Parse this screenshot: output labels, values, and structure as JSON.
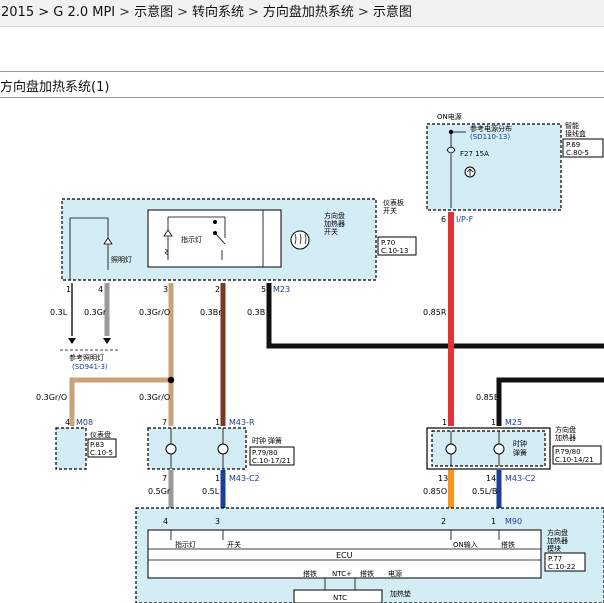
{
  "breadcrumb": {
    "items": [
      "2015 > G 2.0 MPI",
      "示意图",
      "转向系统",
      "方向盘加热系统",
      "示意图"
    ],
    "separator": ">"
  },
  "page_title": "方向盘加热系统(1)",
  "diagram": {
    "top_right_box": {
      "label": "ON电源",
      "ref_label": "参考电源分布",
      "ref_code": "(SD110-13)",
      "fuse": "F27 15A",
      "module_name": [
        "智能",
        "接线盒"
      ],
      "page_ref": [
        "P.69",
        "C.80-5"
      ],
      "pin": "6",
      "connector": "I/P-F"
    },
    "instrument_panel_box": {
      "name": [
        "仪表板",
        "开关"
      ],
      "switch_name": [
        "方向盘",
        "加热器",
        "开关"
      ],
      "page_ref": [
        "P.70",
        "C.10-13"
      ],
      "indicator_label": "指示灯",
      "illum_label": "照明灯",
      "pins": [
        "1",
        "4",
        "3",
        "2",
        "5"
      ],
      "connector": "M23"
    },
    "wire_labels_upper": [
      "0.3L",
      "0.3Gr",
      "0.3Gr/O",
      "0.3Br",
      "0.3B",
      "0.85R",
      "0.85B"
    ],
    "ref_illum": {
      "label": "参考照明灯",
      "code": "(SD941-3)"
    },
    "cluster": {
      "wire": "0.3Gr/O",
      "pin": "4",
      "connector": "M08",
      "name": "仪表盘",
      "page_ref": [
        "P.83",
        "C.10-5"
      ]
    },
    "clock_spring_left": {
      "pins": [
        "7",
        "1"
      ],
      "connector_top": "M43-R",
      "name": [
        "时钟",
        "弹簧"
      ],
      "page_ref": [
        "P.79/80",
        "C.10-17/21"
      ],
      "pins_bottom": [
        "7",
        "1"
      ],
      "connector_bottom": "M43-C2"
    },
    "steering_heater": {
      "pins": [
        "1",
        "1"
      ],
      "connector_top": "M25",
      "name": [
        "方向盘",
        "加热器"
      ],
      "inner_label": [
        "时钟",
        "弹簧"
      ],
      "page_ref": [
        "P.79/80",
        "C.10-14/21"
      ],
      "pins_bottom": [
        "13",
        "14"
      ],
      "connector_bottom": "M43-C2"
    },
    "wire_labels_lower": [
      "0.5Gr",
      "0.5L",
      "0.85O",
      "0.5L/B"
    ],
    "ecu_module": {
      "pins": [
        "4",
        "3",
        "2",
        "1"
      ],
      "connector": "M90",
      "name": [
        "方向盘",
        "加热器",
        "模块"
      ],
      "page_ref": [
        "P.77",
        "C.10-22"
      ],
      "ecu_label": "ECU",
      "inputs": [
        "指示灯",
        "开关",
        "ON输入",
        "搭铁"
      ],
      "bottom_labels": [
        "搭铁",
        "NTC+",
        "搭铁",
        "电源"
      ],
      "ntc": "NTC",
      "heater_pad": "加热垫"
    }
  },
  "colors": {
    "box_fill": "#d4ecf3",
    "red_wire": "#e8303a",
    "brown_wire": "#7b3a22",
    "tan_wire": "#c9a27a",
    "gray_wire": "#9a9a9a",
    "blue_wire": "#1a3e9a",
    "orange_wire": "#f7941d",
    "black_wire": "#111111",
    "connector_text": "#1a3e9a"
  }
}
